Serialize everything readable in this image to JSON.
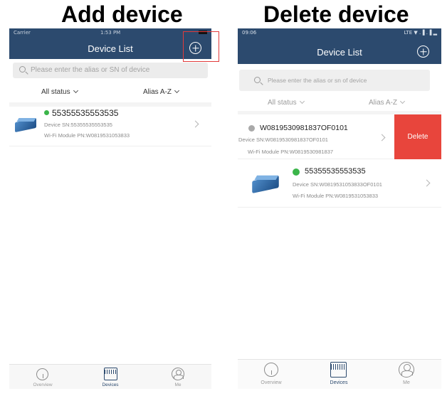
{
  "captions": {
    "left": "Add device",
    "right": "Delete device"
  },
  "left_phone": {
    "status": {
      "carrier": "Carrier",
      "time": "1:53 PM"
    },
    "title": "Device List",
    "search_placeholder": "Please enter the alias or SN of device",
    "filters": {
      "status": "All status",
      "sort": "Alias A-Z"
    },
    "devices": [
      {
        "name": "55355535553535",
        "online": true,
        "sn": "Device SN:55355535553535",
        "pn": "Wi-Fi Module PN:W0819531053833"
      }
    ],
    "tabs": [
      "Overview",
      "Devices",
      "Me"
    ]
  },
  "right_phone": {
    "status": {
      "time": "09:06",
      "signal": "  LTE ▼ .▐ .▐ ▂"
    },
    "title": "Device List",
    "search_placeholder": "Please enter the alias or sn of device",
    "filters": {
      "status": "All status",
      "sort": "Alias A-Z"
    },
    "devices": [
      {
        "name": "W0819530981837OF0101",
        "online": false,
        "sn": "Device SN:W0819530981837OF0101",
        "pn": "Wi-Fi Module PN:W0819530981837"
      },
      {
        "name": "55355535553535",
        "online": true,
        "sn": "Device SN:W0819531053833OF0101",
        "pn": "Wi-Fi Module PN:W0819531053833"
      }
    ],
    "delete_label": "Delete",
    "tabs": [
      "Overview",
      "Devices",
      "Me"
    ]
  },
  "colors": {
    "navbar": "#2c4a6e",
    "online": "#3bb54a",
    "offline": "#a9a9a9",
    "delete": "#e8453c"
  }
}
